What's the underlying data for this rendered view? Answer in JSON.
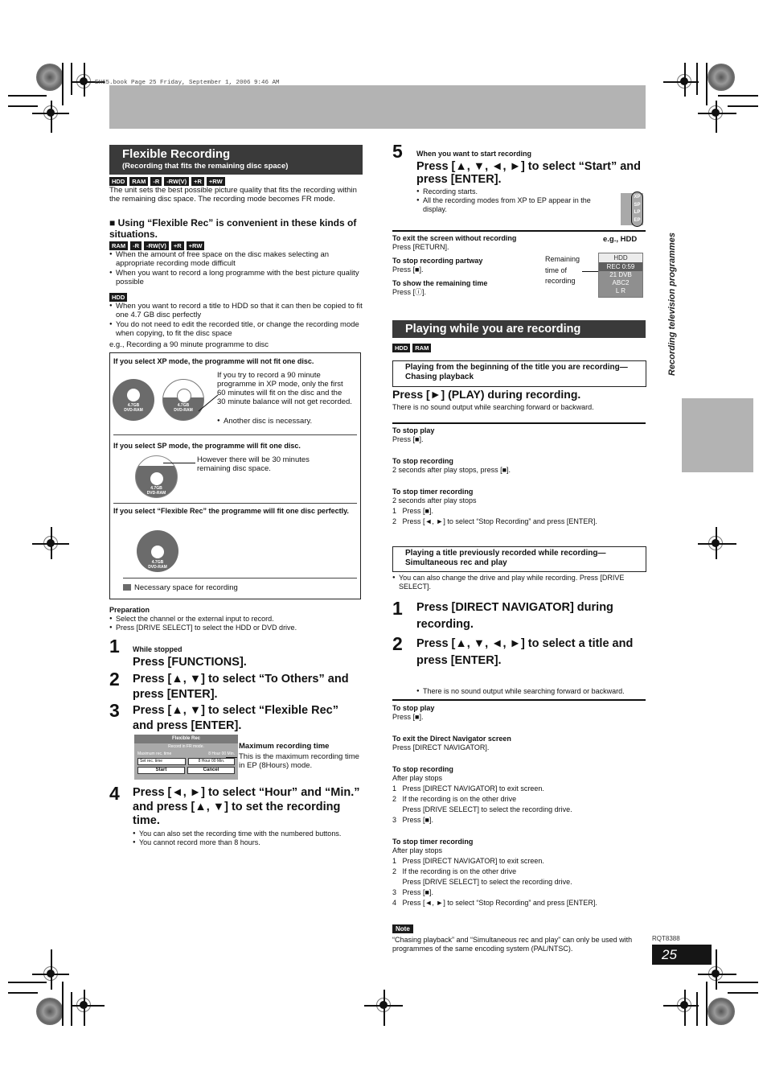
{
  "print_header": "EH65.book  Page 25  Friday, September 1, 2006  9:46 AM",
  "side_label": "Recording television programmes",
  "doc_code": "RQT8388",
  "page_number": "25",
  "flexible": {
    "title": "Flexible Recording",
    "subtitle": "(Recording that fits the remaining disc space)",
    "badges": [
      "HDD",
      "RAM",
      "-R",
      "-RW(V)",
      "+R",
      "+RW"
    ],
    "intro": "The unit sets the best possible picture quality that fits the recording within the remaining disc space. The recording mode becomes FR mode.",
    "convenient_heading": "■ Using “Flexible Rec” is convenient in these kinds of situations.",
    "disc_badges": [
      "RAM",
      "-R",
      "-RW(V)",
      "+R",
      "+RW"
    ],
    "disc_bullets": [
      "When the amount of free space on the disc makes selecting an appropriate recording mode difficult",
      "When you want to record a long programme with the best picture quality possible"
    ],
    "hdd_badge": "HDD",
    "hdd_bullets": [
      "When you want to record a title to HDD so that it can then be copied to fit one 4.7 GB disc perfectly",
      "You do not need to edit the recorded title, or change the recording mode when copying, to fit the disc space"
    ],
    "example": "e.g., Recording a 90 minute programme to disc",
    "diagram": {
      "xp_heading": "If you select XP mode, the programme will not fit one disc.",
      "xp_text": "If you try to record a 90 minute programme in XP mode, only the first 60 minutes will fit on the disc and the 30 minute balance will not get recorded.",
      "xp_bullet": "Another disc is necessary.",
      "sp_heading": "If you select SP mode, the programme will fit one disc.",
      "sp_text": "However there will be 30 minutes remaining disc space.",
      "fr_heading": "If you select “Flexible Rec” the programme will fit one disc perfectly.",
      "disc_label_1": "4.7GB",
      "disc_label_2": "DVD-RAM",
      "legend": "Necessary space for recording"
    },
    "preparation_title": "Preparation",
    "preparation": [
      "Select the channel or the external input to record.",
      "Press [DRIVE SELECT] to select the HDD or DVD drive."
    ],
    "steps": [
      {
        "num": "1",
        "pre": "While stopped",
        "text": "Press [FUNCTIONS]."
      },
      {
        "num": "2",
        "text": "Press [▲, ▼] to select “To Others” and press [ENTER]."
      },
      {
        "num": "3",
        "text": "Press [▲, ▼] to select “Flexible Rec” and press [ENTER]."
      },
      {
        "num": "4",
        "text": "Press [◄, ►] to select “Hour” and “Min.” and press [▲, ▼] to set the recording time.",
        "bullets": [
          "You can also set the recording time with the numbered buttons.",
          "You cannot record more than 8 hours."
        ]
      }
    ],
    "screen": {
      "title": "Flexible Rec",
      "line1": "Record in FR mode.",
      "max_label": "Maximum rec. time",
      "max_value": "8 Hour 00 Min.",
      "set_label": "Set rec. time",
      "set_value": "8 Hour 00 Min.",
      "start": "Start",
      "cancel": "Cancel"
    },
    "max_time_title": "Maximum recording time",
    "max_time_text": "This is the maximum recording time in EP (8Hours) mode."
  },
  "step5": {
    "num": "5",
    "pre": "When you want to start recording",
    "text": "Press [▲, ▼, ◄, ►] to select “Start” and press [ENTER].",
    "bullets": [
      "Recording starts.",
      "All the recording modes from XP to EP appear in the display."
    ],
    "modes": [
      "XP",
      "SP",
      "LP",
      "EP"
    ]
  },
  "rec_tips": [
    {
      "title": "To exit the screen without recording",
      "text": "Press [RETURN]."
    },
    {
      "title": "To stop recording partway",
      "text": "Press [■]."
    },
    {
      "title": "To show the remaining time",
      "text": "Press [ⓘ]."
    }
  ],
  "rec_display": {
    "eg": "e.g., HDD",
    "callout": "Remaining time of recording",
    "rows": [
      "HDD",
      "REC 0:59",
      "21 DVB",
      "ABC2",
      "L R"
    ]
  },
  "playing": {
    "title": "Playing while you are recording",
    "badges": [
      "HDD",
      "RAM"
    ],
    "chasing_box": "Playing from the beginning of the title you are recording—Chasing playback",
    "chasing_step": "Press [►] (PLAY) during recording.",
    "chasing_note": "There is no sound output while searching forward or backward.",
    "chasing_tips": [
      {
        "title": "To stop play",
        "lines": [
          "Press [■]."
        ]
      },
      {
        "title": "To stop recording",
        "lines": [
          "2 seconds after play stops, press [■]."
        ]
      },
      {
        "title": "To stop timer recording",
        "lines": [
          "2 seconds after play stops",
          "1   Press [■].",
          "2   Press [◄, ►] to select “Stop Recording” and press [ENTER]."
        ]
      }
    ],
    "simul_box": "Playing a title previously recorded while recording—Simultaneous rec and play",
    "simul_note": "You can also change the drive and play while recording. Press [DRIVE SELECT].",
    "simul_steps": [
      {
        "num": "1",
        "text": "Press [DIRECT NAVIGATOR] during recording."
      },
      {
        "num": "2",
        "text": "Press [▲, ▼, ◄, ►] to select a title and press [ENTER].",
        "bullet": "There is no sound output while searching forward or backward."
      }
    ],
    "simul_tips": [
      {
        "title": "To stop play",
        "lines": [
          "Press [■]."
        ]
      },
      {
        "title": "To exit the Direct Navigator screen",
        "lines": [
          "Press [DIRECT NAVIGATOR]."
        ]
      },
      {
        "title": "To stop recording",
        "lines": [
          "After play stops",
          "1   Press [DIRECT NAVIGATOR] to exit screen.",
          "2   If the recording is on the other drive",
          "     Press [DRIVE SELECT] to select the recording drive.",
          "3   Press [■]."
        ]
      },
      {
        "title": "To stop timer recording",
        "lines": [
          "After play stops",
          "1   Press [DIRECT NAVIGATOR] to exit screen.",
          "2   If the recording is on the other drive",
          "     Press [DRIVE SELECT] to select the recording drive.",
          "3   Press [■].",
          "4   Press [◄, ►] to select “Stop Recording” and press [ENTER]."
        ]
      }
    ],
    "note_label": "Note",
    "note_text": "“Chasing playback” and “Simultaneous rec and play” can only be used with programmes of the same encoding system (PAL/NTSC)."
  }
}
